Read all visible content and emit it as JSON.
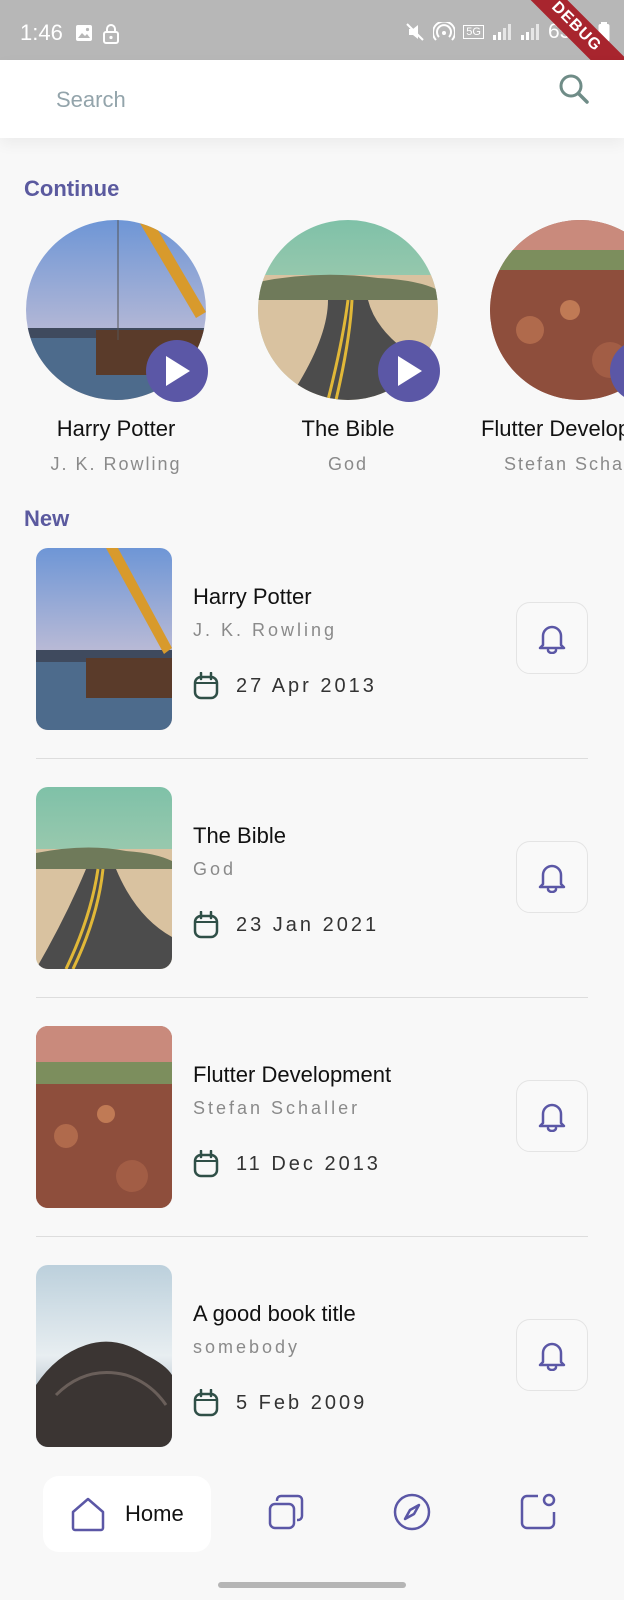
{
  "status_bar": {
    "time": "1:46",
    "battery": "65%",
    "network_badge": "5G",
    "debug_banner": "DEBUG"
  },
  "search": {
    "placeholder": "Search"
  },
  "sections": {
    "continue_title": "Continue",
    "new_title": "New"
  },
  "continue_items": [
    {
      "title": "Harry Potter",
      "author": "J. K. Rowling"
    },
    {
      "title": "The Bible",
      "author": "God"
    },
    {
      "title": "Flutter Development",
      "author": "Stefan Schaller"
    }
  ],
  "new_items": [
    {
      "title": "Harry Potter",
      "author": "J. K. Rowling",
      "date": "27 Apr 2013"
    },
    {
      "title": "The Bible",
      "author": "God",
      "date": "23 Jan 2021"
    },
    {
      "title": "Flutter Development",
      "author": "Stefan Schaller",
      "date": "11 Dec 2013"
    },
    {
      "title": "A good book title",
      "author": "somebody",
      "date": "5 Feb 2009"
    }
  ],
  "bottom_nav": {
    "home_label": "Home"
  },
  "colors": {
    "accent": "#5b57a6",
    "section_title": "#5b5a9f",
    "date_icon": "#2f4f47"
  },
  "icons": {
    "search": "search-icon",
    "play": "play-icon",
    "bell": "bell-icon",
    "calendar": "calendar-icon",
    "home": "home-icon",
    "library": "library-icon",
    "explore": "compass-icon",
    "notifications": "notification-icon"
  }
}
